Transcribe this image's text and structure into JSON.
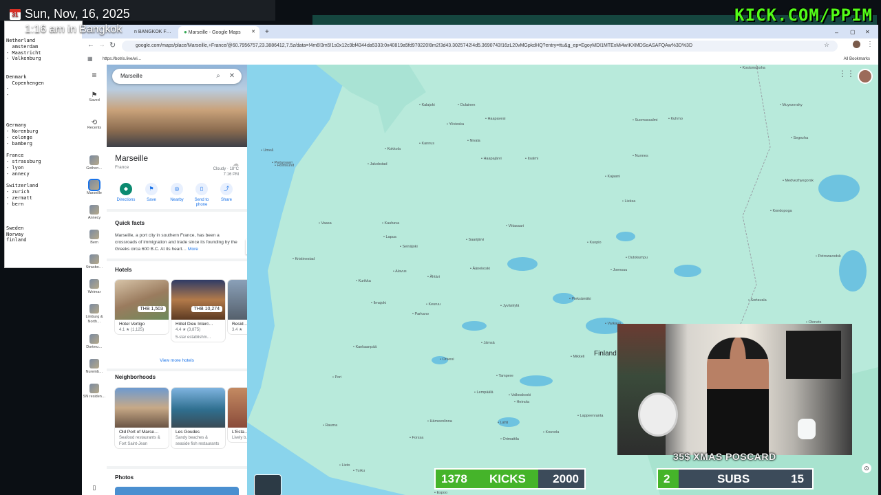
{
  "overlay": {
    "date": "Sun, Nov, 16, 2025",
    "time": "1:16 am in Bangkok",
    "brand": "KICK.COM/PPIM",
    "calendar_icon_text": "31"
  },
  "notepad": {
    "lines": "Netherland\n  amsterdam\n- Maastricht\n- Valkenburg\n\n\nDenmark\n  Copenhengen\n-\n-\n\n\n\n\nGermany\n- Norenburg\n- colonge\n- bamberg\n\nFrance\n- strassburg\n- lyon\n- annecy\n\nSwitzerland\n- zurich\n- zermatt\n- bern\n\n\n\nSweden\nNorway\nfinland"
  },
  "browser": {
    "tabs": [
      "n BANGKOK F…",
      "Marseille - Google Maps"
    ],
    "url": "google.com/maps/place/Marseille,+France/@60.7956757,23.3886412,7.5z/data=!4m6!3m5!1s0x12c9bf4344da5333:0x40819a5fd970220!8m2!3d43.3025742!4d5.3690743!16zL20vMGpkdHQ?entry=ttu&g_ep=EgoyMDI1MTExMi4wIKXMDSoASAFQAw%3D%3D",
    "bookmark": "https://botris.live/wi…",
    "all_bookmarks": "All Bookmarks"
  },
  "rail": [
    {
      "label": "Saved"
    },
    {
      "label": "Recents"
    },
    {
      "label": "Gothen…"
    },
    {
      "label": "Marseille"
    },
    {
      "label": "Annecy"
    },
    {
      "label": "Bern"
    },
    {
      "label": "Strasbo…"
    },
    {
      "label": "Weimar"
    },
    {
      "label": "Limburg & North…"
    },
    {
      "label": "Dortmu…"
    },
    {
      "label": "Nuremb…"
    },
    {
      "label": "SN residen…"
    }
  ],
  "panel": {
    "search_value": "Marseille",
    "title": "Marseille",
    "country": "France",
    "weather_cond": "Cloudy · 18°C",
    "weather_time": "7:16 PM",
    "actions": [
      "Directions",
      "Save",
      "Nearby",
      "Send to phone",
      "Share"
    ],
    "quick_facts_heading": "Quick facts",
    "quick_facts_text": "Marseille, a port city in southern France, has been a crossroads of immigration and trade since its founding by the Greeks circa 600 B.C. At its heart…",
    "more_link": "More",
    "hotels_heading": "Hotels",
    "hotels": [
      {
        "name": "Hotel Vertigo",
        "rating": "4.1 ★ (1,125)",
        "price": "THB 1,503",
        "sub": ""
      },
      {
        "name": "Hôtel Dieu Interc…",
        "rating": "4.4 ★ (3,875)",
        "price": "THB 10,274",
        "sub": "5-star establishm…"
      },
      {
        "name": "Resid…",
        "rating": "3.4 ★",
        "price": "",
        "sub": ""
      }
    ],
    "view_more_hotels": "View more hotels",
    "neighborhoods_heading": "Neighborhoods",
    "neighborhoods": [
      {
        "name": "Old Port of Marse…",
        "desc": "Seafood restaurants & Fort Saint-Jean"
      },
      {
        "name": "Les Goudes",
        "desc": "Sandy beaches & seaside fish restaurants"
      },
      {
        "name": "L'Esta…",
        "desc": "Lively b… restau…"
      }
    ],
    "photos_heading": "Photos"
  },
  "map": {
    "country_label": "Finland",
    "cities": [
      {
        "name": "Kalajoki"
      },
      {
        "name": "Oulainen"
      },
      {
        "name": "Ylivieska"
      },
      {
        "name": "Haapavesi"
      },
      {
        "name": "Kokkola"
      },
      {
        "name": "Kannus"
      },
      {
        "name": "Nivala"
      },
      {
        "name": "Haapajärvi"
      },
      {
        "name": "Jakobstad"
      },
      {
        "name": "Pietarsaari"
      },
      {
        "name": "Vaasa"
      },
      {
        "name": "Kauhava"
      },
      {
        "name": "Lapua"
      },
      {
        "name": "Seinäjoki"
      },
      {
        "name": "Alavus"
      },
      {
        "name": "Ähtäri"
      },
      {
        "name": "Keuruu"
      },
      {
        "name": "Jyväskylä"
      },
      {
        "name": "Jämsä"
      },
      {
        "name": "Orivesi"
      },
      {
        "name": "Tampere"
      },
      {
        "name": "Lempäälä"
      },
      {
        "name": "Valkeakoski"
      },
      {
        "name": "Heinola"
      },
      {
        "name": "Lahti"
      },
      {
        "name": "Hämeenlinna"
      },
      {
        "name": "Forssa"
      },
      {
        "name": "Orimattila"
      },
      {
        "name": "Kouvola"
      },
      {
        "name": "Lappeenranta"
      },
      {
        "name": "Mikkeli"
      },
      {
        "name": "Varkaus"
      },
      {
        "name": "Kuopio"
      },
      {
        "name": "Iisalmi"
      },
      {
        "name": "Joensuu"
      },
      {
        "name": "Lieksa"
      },
      {
        "name": "Kajaani"
      },
      {
        "name": "Kuhmo"
      },
      {
        "name": "Suomussalmi"
      },
      {
        "name": "Pori"
      },
      {
        "name": "Rauma"
      },
      {
        "name": "Turku"
      },
      {
        "name": "Espoo"
      },
      {
        "name": "Kristinestad"
      },
      {
        "name": "Kurikka"
      },
      {
        "name": "Ilmajoki"
      },
      {
        "name": "Kankaanpää"
      },
      {
        "name": "Parkano"
      },
      {
        "name": "Viitasaari"
      },
      {
        "name": "Saarijärvi"
      },
      {
        "name": "Äänekoski"
      },
      {
        "name": "Pieksämäki"
      },
      {
        "name": "Savonlinna"
      },
      {
        "name": "Outokumpu"
      },
      {
        "name": "Lieto"
      },
      {
        "name": "Umeå"
      },
      {
        "name": "Holmsund"
      },
      {
        "name": "Nurmes"
      },
      {
        "name": "Kostomuksha"
      },
      {
        "name": "Muyezersky"
      },
      {
        "name": "Segezha"
      },
      {
        "name": "Medvezhyegorsk"
      },
      {
        "name": "Kondopoga"
      },
      {
        "name": "Petrozavodsk"
      },
      {
        "name": "Sortavala"
      },
      {
        "name": "Olonets"
      }
    ]
  },
  "goals": {
    "kicks_current": "1378",
    "kicks_label": "KICKS",
    "kicks_target": "2000",
    "kicks_fraction": 0.689,
    "subs_current": "2",
    "subs_label": "SUBS",
    "subs_target": "15",
    "subs_fraction": 0.133,
    "xmas_label": "35$ XMAS POSCARD"
  },
  "colors": {
    "brand_green": "#53fc18",
    "goal_fill": "#45b42a",
    "map_land": "#b8eadb",
    "map_water": "#8ad4ec",
    "maps_primary": "#1a73e8"
  }
}
